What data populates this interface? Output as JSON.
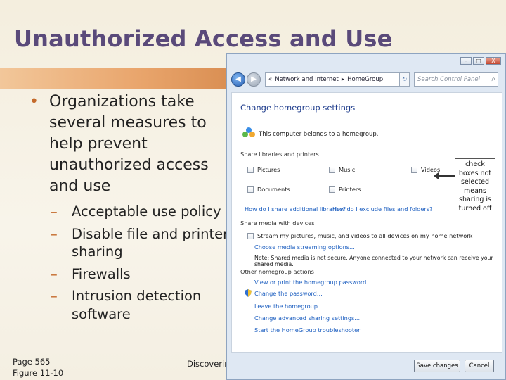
{
  "slide": {
    "title": "Unauthorized Access and Use",
    "bullet": "Organizations take several measures to help prevent unauthorized access and use",
    "sub_bullets": [
      "Acceptable use policy",
      "Disable file and printer sharing",
      "Firewalls",
      "Intrusion detection software"
    ],
    "footer_page": "Page 565",
    "footer_figure": "Figure 11-10",
    "footer_middle": "Discovering"
  },
  "window": {
    "controls": {
      "minimize": "–",
      "maximize": "□",
      "close": "X"
    },
    "address": {
      "prefix": "«",
      "crumb1": "Network and Internet",
      "sep": "▸",
      "crumb2": "HomeGroup"
    },
    "search_placeholder": "Search Control Panel",
    "heading": "Change homegroup settings",
    "belongs_text": "This computer belongs to a homegroup.",
    "share_section": "Share libraries and printers",
    "libraries": [
      "Pictures",
      "Music",
      "Videos",
      "Documents",
      "Printers"
    ],
    "link_share_additional": "How do I share additional libraries?",
    "link_exclude": "How do I exclude files and folders?",
    "media_section": "Share media with devices",
    "media_checkbox": "Stream my pictures, music, and videos to all devices on my home network",
    "link_media_options": "Choose media streaming options...",
    "media_note": "Note: Shared media is not secure. Anyone connected to your network can receive your shared media.",
    "actions_section": "Other homegroup actions",
    "actions": [
      "View or print the homegroup password",
      "Change the password...",
      "Leave the homegroup...",
      "Change advanced sharing settings...",
      "Start the HomeGroup troubleshooter"
    ],
    "callout": "check boxes not selected means sharing is turned off",
    "save_button": "Save changes",
    "cancel_button": "Cancel"
  }
}
